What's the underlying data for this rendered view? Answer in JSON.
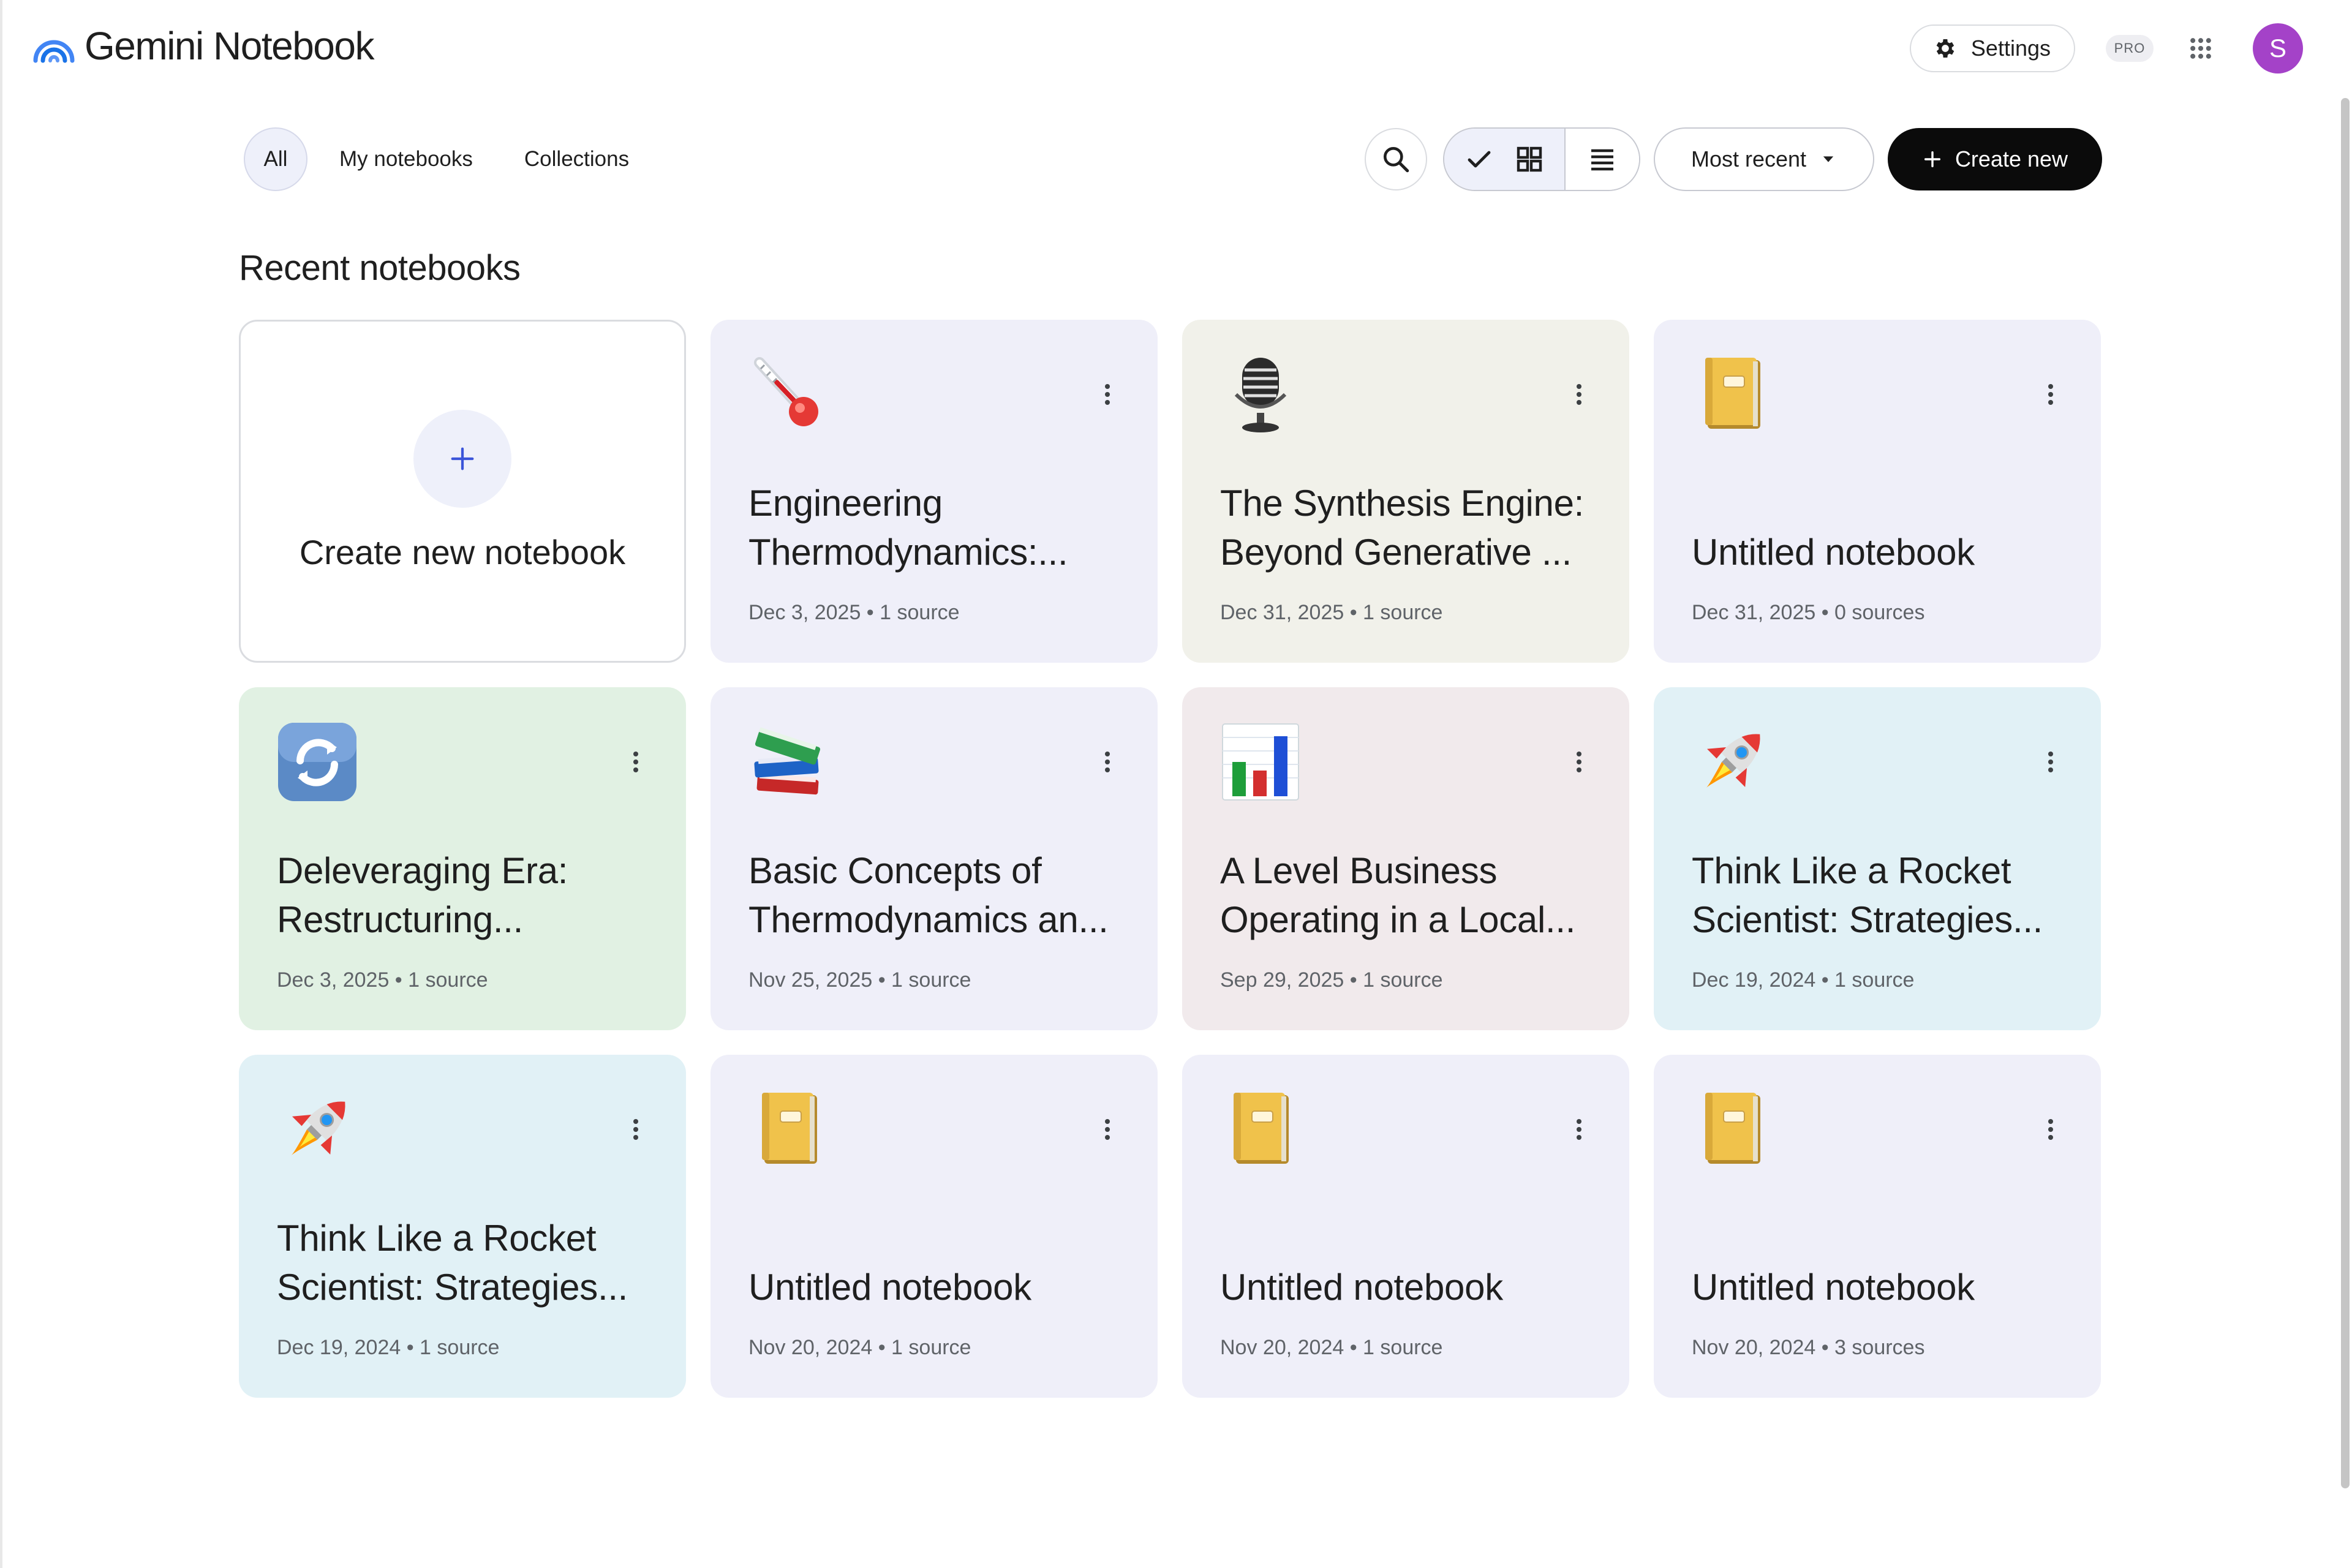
{
  "app": {
    "title": "Gemini Notebook",
    "brand_color": "#4285f4"
  },
  "header": {
    "settings_label": "Settings",
    "settings_icon": "gear-icon",
    "pro_badge": "PRO",
    "apps_icon": "apps-grid-icon",
    "avatar_initial": "S",
    "avatar_color": "#a442c8"
  },
  "filters": {
    "tabs": [
      {
        "label": "All",
        "active": true
      },
      {
        "label": "My notebooks",
        "active": false
      },
      {
        "label": "Collections",
        "active": false
      }
    ]
  },
  "toolbar": {
    "search_icon": "search-icon",
    "view_grid_icons": [
      "check-icon",
      "grid-view-icon"
    ],
    "view_list_icon": "list-view-icon",
    "sort_label": "Most recent",
    "create_label": "Create new"
  },
  "section": {
    "title": "Recent notebooks"
  },
  "create_card": {
    "label": "Create new notebook"
  },
  "notebooks": [
    {
      "emoji": "🌡️",
      "title": "Engineering Thermodynamics:...",
      "meta": "Dec 3, 2025 • 1 source",
      "color": "#efeff9"
    },
    {
      "emoji": "🎙️",
      "title": "The Synthesis Engine: Beyond Generative ...",
      "meta": "Dec 31, 2025 • 1 source",
      "color": "#f1f1ea"
    },
    {
      "emoji": "📒",
      "title": "Untitled notebook",
      "meta": "Dec 31, 2025 • 0 sources",
      "color": "#efeff9"
    },
    {
      "emoji": "🔄",
      "title": "Deleveraging Era: Restructuring...",
      "meta": "Dec 3, 2025 • 1 source",
      "color": "#e1f1e3"
    },
    {
      "emoji": "📚",
      "title": "Basic Concepts of Thermodynamics an...",
      "meta": "Nov 25, 2025 • 1 source",
      "color": "#efeff9"
    },
    {
      "emoji": "📊",
      "title": "A Level Business Operating in a Local...",
      "meta": "Sep 29, 2025 • 1 source",
      "color": "#f1eaec"
    },
    {
      "emoji": "🚀",
      "title": "Think Like a Rocket Scientist: Strategies...",
      "meta": "Dec 19, 2024 • 1 source",
      "color": "#e1f1f6"
    },
    {
      "emoji": "🚀",
      "title": "Think Like a Rocket Scientist: Strategies...",
      "meta": "Dec 19, 2024 • 1 source",
      "color": "#e1f1f6"
    },
    {
      "emoji": "📒",
      "title": "Untitled notebook",
      "meta": "Nov 20, 2024 • 1 source",
      "color": "#efeff9"
    },
    {
      "emoji": "📒",
      "title": "Untitled notebook",
      "meta": "Nov 20, 2024 • 1 source",
      "color": "#efeff9"
    },
    {
      "emoji": "📒",
      "title": "Untitled notebook",
      "meta": "Nov 20, 2024 • 3 sources",
      "color": "#efeff9"
    }
  ]
}
